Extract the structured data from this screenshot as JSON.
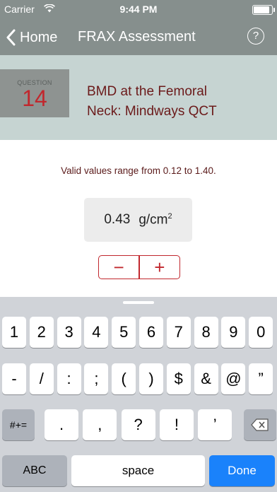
{
  "status_bar": {
    "carrier": "Carrier",
    "time": "9:44 PM"
  },
  "nav": {
    "back_label": "Home",
    "title": "FRAX Assessment",
    "help_label": "?"
  },
  "question": {
    "label": "QUESTION",
    "number": "14",
    "text_line1": "BMD at the Femoral",
    "text_line2": "Neck: Mindways QCT"
  },
  "main": {
    "valid_range": "Valid values range from 0.12 to 1.40.",
    "value": "0.43",
    "unit": "g/cm",
    "unit_sup": "2",
    "minus": "−",
    "plus": "+"
  },
  "keyboard": {
    "row1": [
      "1",
      "2",
      "3",
      "4",
      "5",
      "6",
      "7",
      "8",
      "9",
      "0"
    ],
    "row2": [
      "-",
      "/",
      ":",
      ";",
      "(",
      ")",
      "$",
      "&",
      "@",
      "”"
    ],
    "row3_toggle": "#+=",
    "row3": [
      ".",
      ",",
      "?",
      "!",
      "’"
    ],
    "abc": "ABC",
    "space": "space",
    "done": "Done"
  },
  "colors": {
    "nav_bg": "#868f8d",
    "question_band": "#c6d4d2",
    "accent": "#c1272d",
    "done_blue": "#1a82fb"
  }
}
